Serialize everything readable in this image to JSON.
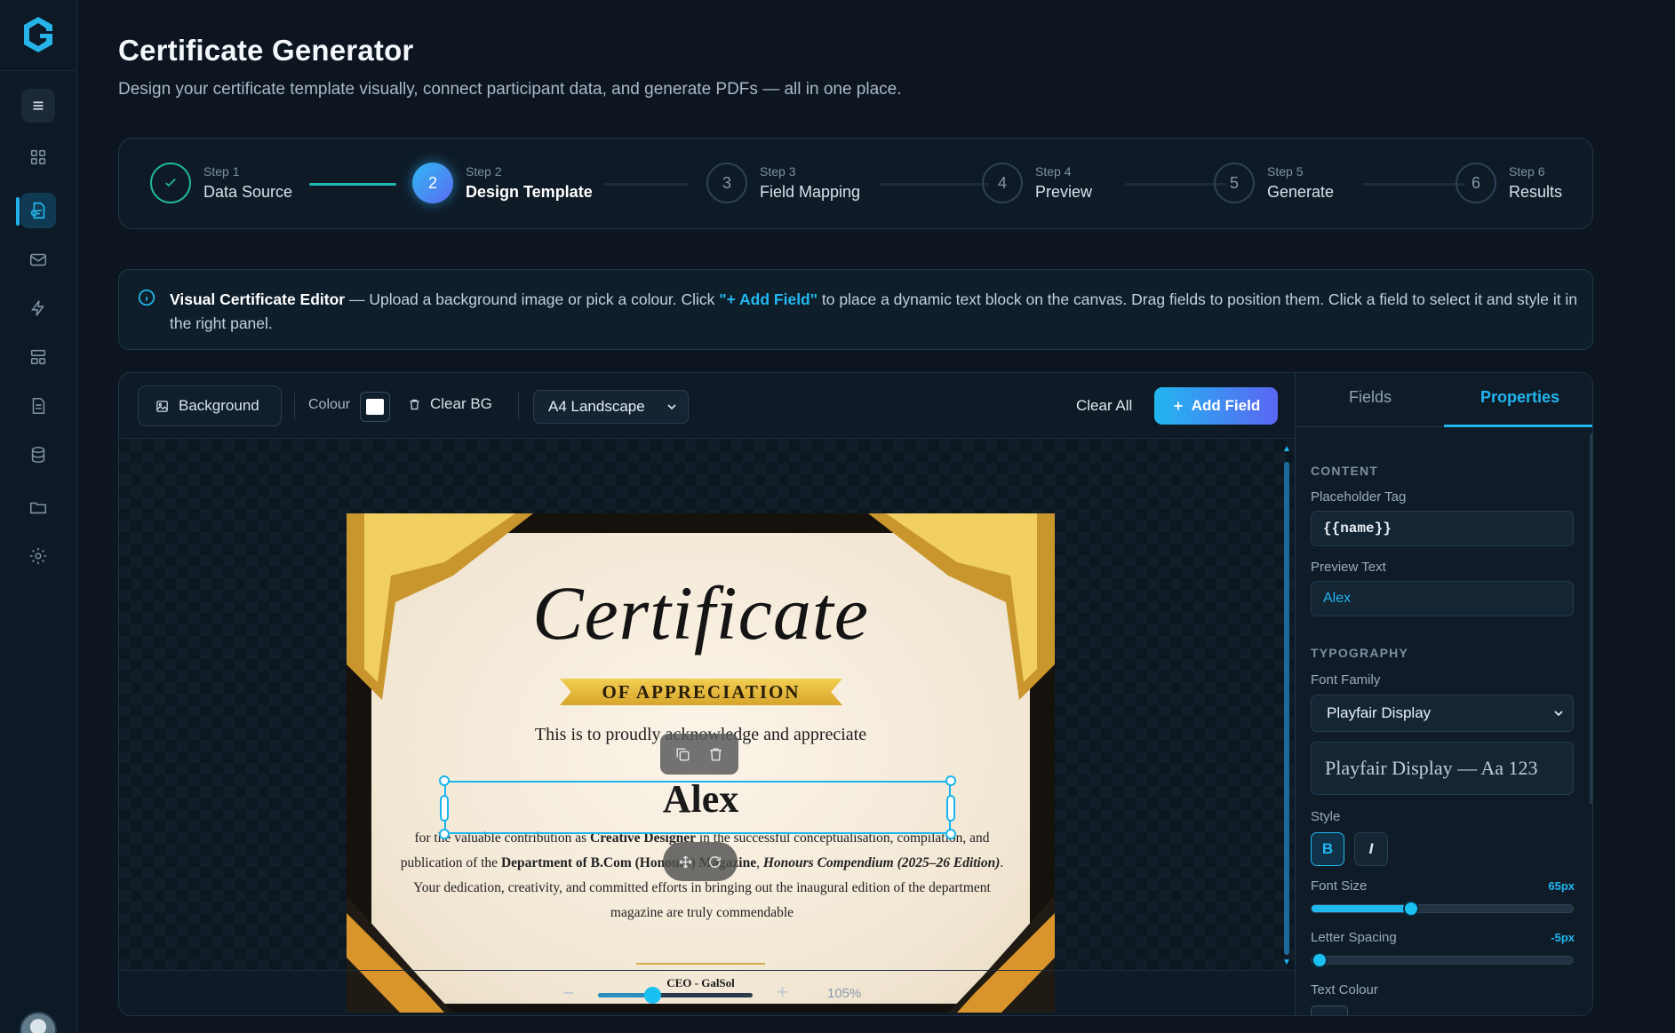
{
  "app": {
    "title": "Certificate Generator",
    "subtitle": "Design your certificate template visually, connect participant data, and generate PDFs — all in one place."
  },
  "sidebar": {
    "items": [
      {
        "name": "menu",
        "icon": "menu-icon"
      },
      {
        "name": "dashboard",
        "icon": "grid-icon"
      },
      {
        "name": "certificates",
        "icon": "certificate-icon",
        "active": true
      },
      {
        "name": "mail",
        "icon": "mail-icon"
      },
      {
        "name": "automation",
        "icon": "lightning-icon"
      },
      {
        "name": "templates",
        "icon": "layout-icon"
      },
      {
        "name": "documents",
        "icon": "document-icon"
      },
      {
        "name": "database",
        "icon": "database-icon"
      },
      {
        "name": "folders",
        "icon": "folder-icon"
      },
      {
        "name": "settings",
        "icon": "gear-icon"
      }
    ]
  },
  "stepper": {
    "steps": [
      {
        "small": "Step 1",
        "label": "Data Source",
        "state": "done"
      },
      {
        "small": "Step 2",
        "number": "2",
        "label": "Design Template",
        "state": "active"
      },
      {
        "small": "Step 3",
        "number": "3",
        "label": "Field Mapping",
        "state": "pending"
      },
      {
        "small": "Step 4",
        "number": "4",
        "label": "Preview",
        "state": "pending"
      },
      {
        "small": "Step 5",
        "number": "5",
        "label": "Generate",
        "state": "pending"
      },
      {
        "small": "Step 6",
        "number": "6",
        "label": "Results",
        "state": "pending"
      }
    ]
  },
  "info": {
    "title": "Visual Certificate Editor",
    "text_before": " — Upload a background image or pick a colour. Click ",
    "highlight": "\"+ Add Field\"",
    "text_after": " to place a dynamic text block on the canvas. Drag fields to position them. Click a field to select it and style it in the right panel."
  },
  "toolbar": {
    "background_label": "Background",
    "colour_label": "Colour",
    "colour_value": "#ffffff",
    "clear_bg_label": "Clear BG",
    "page_size": "A4 Landscape",
    "clear_all_label": "Clear All",
    "add_field_label": "Add Field"
  },
  "certificate": {
    "title": "Certificate",
    "ribbon": "OF APPRECIATION",
    "ack": "This is to proudly acknowledge and appreciate",
    "name": "Alex",
    "body": {
      "p1": "for the valuable contribution as ",
      "role": "Creative Designer",
      "p2": " in the successful conceptualisation, compilation, and publication of the ",
      "dept": "Department of B.Com (Honours) Magazine",
      "p3": ", ",
      "work": "Honours Compendium (2025–26 Edition)",
      "p4": ". Your dedication, creativity, and committed efforts in bringing out the inaugural edition of the department magazine are truly commendable"
    },
    "signature": "CEO - GalSol"
  },
  "zoom": {
    "minus": "–",
    "plus": "+",
    "value": "105%",
    "level": 0.35
  },
  "panel": {
    "tabs": [
      "Fields",
      "Properties"
    ],
    "active_tab": "Properties",
    "content_heading": "CONTENT",
    "placeholder_label": "Placeholder Tag",
    "placeholder_value": "{{name}}",
    "preview_label": "Preview Text",
    "preview_value": "Alex",
    "typography_heading": "TYPOGRAPHY",
    "font_family_label": "Font Family",
    "font_family_value": "Playfair Display",
    "font_preview": "Playfair Display — Aa 123",
    "style_label": "Style",
    "bold": "B",
    "italic": "I",
    "font_size_label": "Font Size",
    "font_size_value": "65px",
    "font_size_level": 0.38,
    "letter_spacing_label": "Letter Spacing",
    "letter_spacing_value": "-5px",
    "letter_spacing_level": 0.03,
    "text_colour_label": "Text Colour"
  }
}
